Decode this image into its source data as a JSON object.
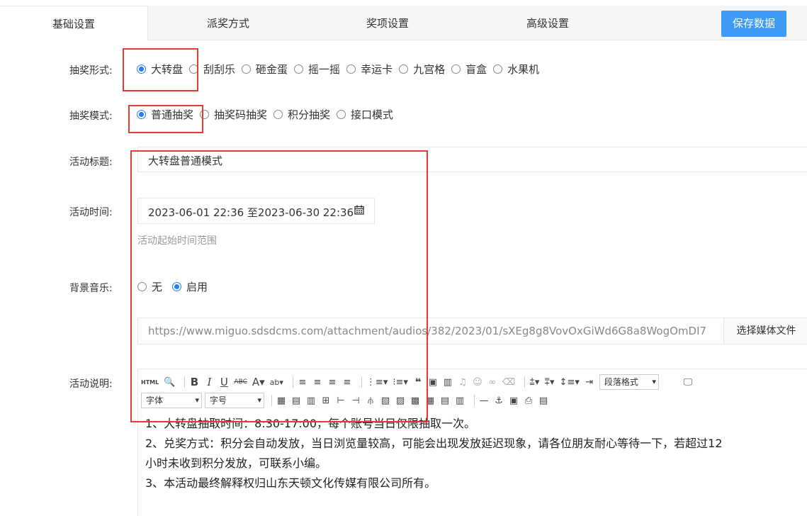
{
  "tabs": [
    {
      "label": "基础设置",
      "active": true
    },
    {
      "label": "派奖方式",
      "active": false
    },
    {
      "label": "奖项设置",
      "active": false
    },
    {
      "label": "高级设置",
      "active": false
    }
  ],
  "save_button": "保存数据",
  "lottery_form": {
    "label": "抽奖形式:",
    "options": [
      "大转盘",
      "刮刮乐",
      "砸金蛋",
      "摇一摇",
      "幸运卡",
      "九宫格",
      "盲盒",
      "水果机"
    ],
    "selected": "大转盘"
  },
  "lottery_mode": {
    "label": "抽奖模式:",
    "options": [
      "普通抽奖",
      "抽奖码抽奖",
      "积分抽奖",
      "接口模式"
    ],
    "selected": "普通抽奖"
  },
  "title_field": {
    "label": "活动标题:",
    "value": "大转盘普通模式"
  },
  "time_field": {
    "label": "活动时间:",
    "value": "2023-06-01 22:36 至2023-06-30 22:36",
    "hint": "活动起始时间范围"
  },
  "music": {
    "label": "背景音乐:",
    "options": [
      "无",
      "启用"
    ],
    "selected": "启用",
    "url": "https://www.miguo.sdsdcms.com/attachment/audios/382/2023/01/sXEg8g8VovOxGiWd6G8a8WogOmDI7",
    "select_button": "选择媒体文件"
  },
  "description": {
    "label": "活动说明:",
    "toolbar": {
      "paragraph": "段落格式",
      "font": "字体",
      "size": "字号"
    },
    "lines": [
      "1、大转盘抽取时间：8:30-17:00，每个账号当日仅限抽取一次。",
      "2、兑奖方式：积分会自动发放，当日浏览量较高，可能会出现发放延迟现象，请各位朋友耐心等待一下，若超过12",
      "小时未收到积分发放，可联系小编。",
      "3、本活动最终解释权归山东天顿文化传媒有限公司所有。"
    ]
  },
  "colors": {
    "accent": "#1e80ff",
    "button": "#3d9af5",
    "highlight": "#e53935"
  }
}
